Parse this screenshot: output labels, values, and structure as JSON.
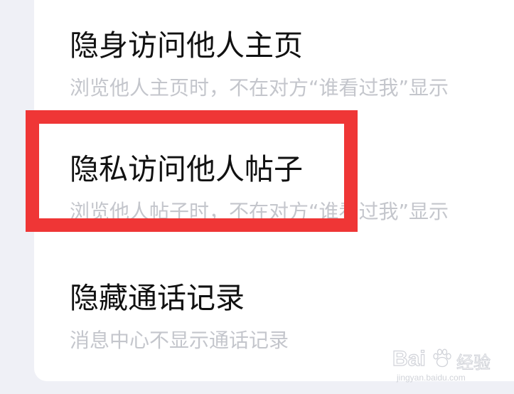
{
  "settings": {
    "items": [
      {
        "title": "隐身访问他人主页",
        "description": "浏览他人主页时，不在对方“谁看过我”显示"
      },
      {
        "title": "隐私访问他人帖子",
        "description": "浏览他人帖子时，不在对方“谁看过我”显示"
      },
      {
        "title": "隐藏通话记录",
        "description": "消息中心不显示通话记录"
      }
    ]
  },
  "highlight": {
    "color": "#ef3636",
    "target": "隐私访问他人帖子"
  },
  "watermark": {
    "brand_left": "Bai",
    "brand_right": "经验",
    "url": "jingyan.baidu.com",
    "icon": "baidu-paw-icon"
  },
  "colors": {
    "background": "#eff0f6",
    "card": "#ffffff",
    "title_text": "#111111",
    "description_text": "#c4c6cc"
  }
}
